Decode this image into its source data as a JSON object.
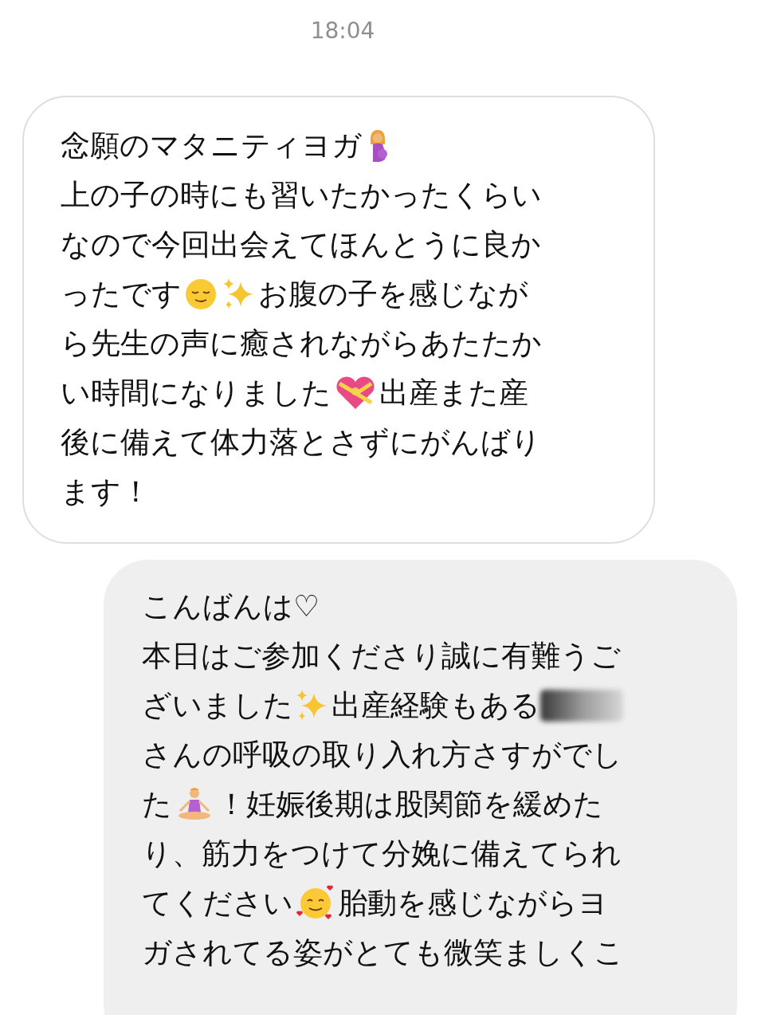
{
  "timestamp": "18:04",
  "messages": [
    {
      "kind": "received",
      "lines": [
        [
          {
            "kind": "text",
            "text": "念願のマタニティヨガ"
          },
          {
            "kind": "pregnant"
          }
        ],
        [
          {
            "kind": "text",
            "text": "上の子の時にも習いたかったくらい"
          }
        ],
        [
          {
            "kind": "text",
            "text": "なので今回出会えてほんとうに良か"
          }
        ],
        [
          {
            "kind": "text",
            "text": "ったです"
          },
          {
            "kind": "relieved"
          },
          {
            "kind": "sparkles"
          },
          {
            "kind": "text",
            "text": "お腹の子を感じなが"
          }
        ],
        [
          {
            "kind": "text",
            "text": "ら先生の声に癒されながらあたたか"
          }
        ],
        [
          {
            "kind": "text",
            "text": "い時間になりました"
          },
          {
            "kind": "giftheart"
          },
          {
            "kind": "text",
            "text": "出産また産"
          }
        ],
        [
          {
            "kind": "text",
            "text": "後に備えて体力落とさずにがんばり"
          }
        ],
        [
          {
            "kind": "text",
            "text": "ます！"
          }
        ]
      ]
    },
    {
      "kind": "sent",
      "lines": [
        [
          {
            "kind": "text",
            "text": "こんばんは♡"
          }
        ],
        [
          {
            "kind": "text",
            "text": "本日はご参加くださり誠に有難うご"
          }
        ],
        [
          {
            "kind": "text",
            "text": "ざいました"
          },
          {
            "kind": "sparkles"
          },
          {
            "kind": "text",
            "text": "出産経験もある"
          },
          {
            "kind": "redacted"
          }
        ],
        [
          {
            "kind": "text",
            "text": "さんの呼吸の取り入れ方さすがでし"
          }
        ],
        [
          {
            "kind": "text",
            "text": "た"
          },
          {
            "kind": "meditation"
          },
          {
            "kind": "text",
            "text": "！妊娠後期は股関節を緩めた"
          }
        ],
        [
          {
            "kind": "text",
            "text": "り、筋力をつけて分娩に備えてられ"
          }
        ],
        [
          {
            "kind": "text",
            "text": "てください"
          },
          {
            "kind": "hearts"
          },
          {
            "kind": "text",
            "text": "胎動を感じながらヨ"
          }
        ],
        [
          {
            "kind": "text",
            "text": "ガされてる姿がとても微笑ましくこ"
          }
        ]
      ]
    }
  ]
}
